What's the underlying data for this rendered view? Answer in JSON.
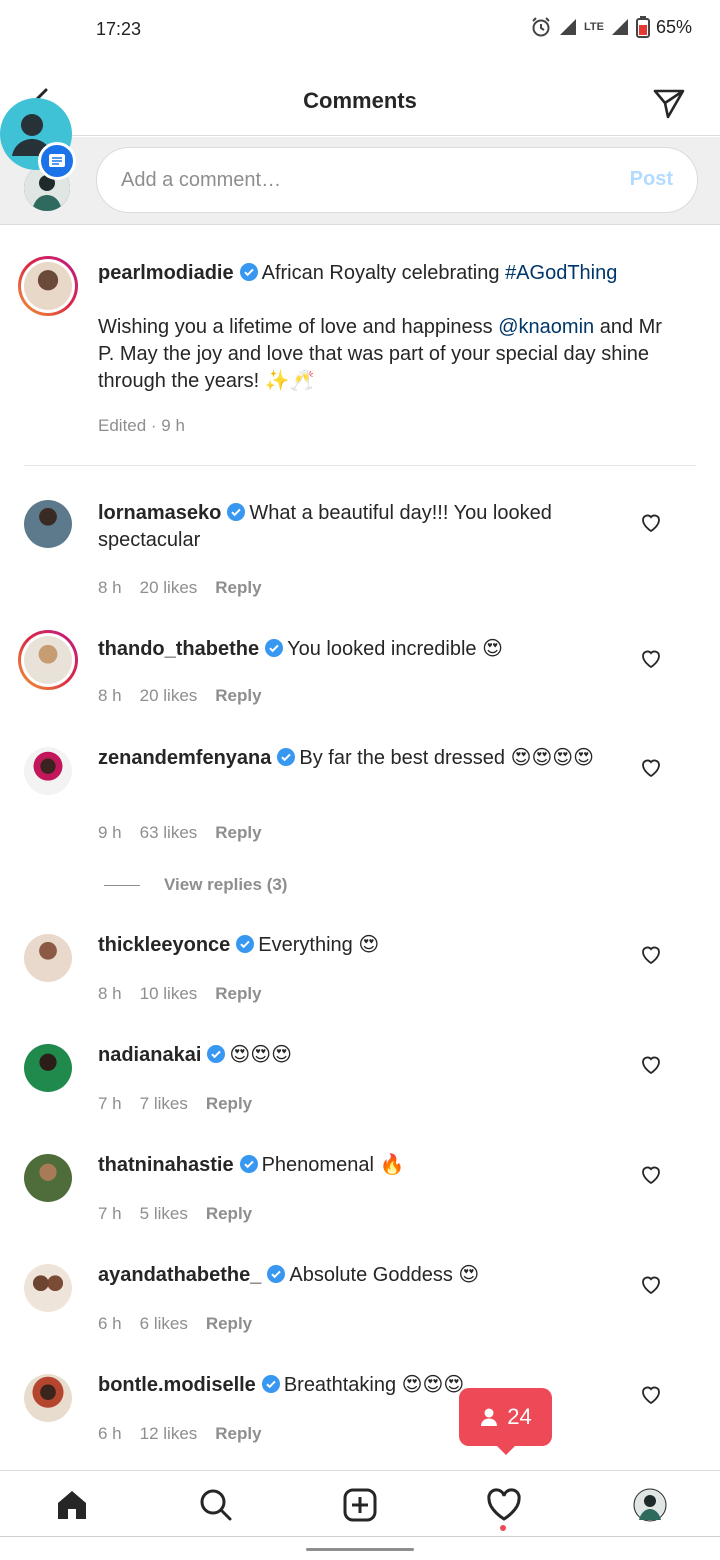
{
  "status_bar": {
    "time": "17:23",
    "network": "LTE",
    "battery": "65%"
  },
  "header": {
    "title": "Comments"
  },
  "compose": {
    "placeholder": "Add a comment…",
    "post_label": "Post"
  },
  "caption": {
    "username": "pearlmodiadie",
    "line1": "African Royalty celebrating ",
    "hashtag": "#AGodThing",
    "line2_a": "Wishing you a lifetime of love and happiness ",
    "mention": "@knaomin",
    "line2_b": " and Mr P. May the joy and love that was part of your special day shine through the years! ✨🥂",
    "meta": "Edited · 9 h"
  },
  "comments": [
    {
      "username": "lornamaseko",
      "text": "What a beautiful day!!! You looked spectacular",
      "time": "8 h",
      "likes": "20 likes",
      "reply": "Reply"
    },
    {
      "username": "thando_thabethe",
      "text": "You looked incredible 😍",
      "time": "8 h",
      "likes": "20 likes",
      "reply": "Reply"
    },
    {
      "username": "zenandemfenyana",
      "text": "By far the best dressed 😍😍😍😍",
      "time": "9 h",
      "likes": "63 likes",
      "reply": "Reply",
      "view_replies": "View replies (3)"
    },
    {
      "username": "thickleeyonce",
      "text": "Everything 😍",
      "time": "8 h",
      "likes": "10 likes",
      "reply": "Reply"
    },
    {
      "username": "nadianakai",
      "text": "😍😍😍",
      "time": "7 h",
      "likes": "7 likes",
      "reply": "Reply"
    },
    {
      "username": "thatninahastie",
      "text": "Phenomenal 🔥",
      "time": "7 h",
      "likes": "5 likes",
      "reply": "Reply"
    },
    {
      "username": "ayandathabethe_",
      "text": "Absolute Goddess 😍",
      "time": "6 h",
      "likes": "6 likes",
      "reply": "Reply"
    },
    {
      "username": "bontle.modiselle",
      "text": "Breathtaking 😍😍😍",
      "time": "6 h",
      "likes": "12 likes",
      "reply": "Reply"
    }
  ],
  "notification": {
    "count": "24"
  },
  "icons": {
    "back": "back-arrow-icon",
    "send": "direct-send-icon",
    "verified": "verified-badge-icon",
    "like": "heart-outline-icon",
    "home": "home-icon",
    "search": "search-icon",
    "add": "add-post-icon",
    "activity": "heart-icon",
    "profile": "profile-avatar"
  },
  "colors": {
    "accent": "#0095f6",
    "post_disabled": "#b3dbff",
    "notif": "#ed4956",
    "link": "#00376b",
    "verified": "#3897f0"
  }
}
